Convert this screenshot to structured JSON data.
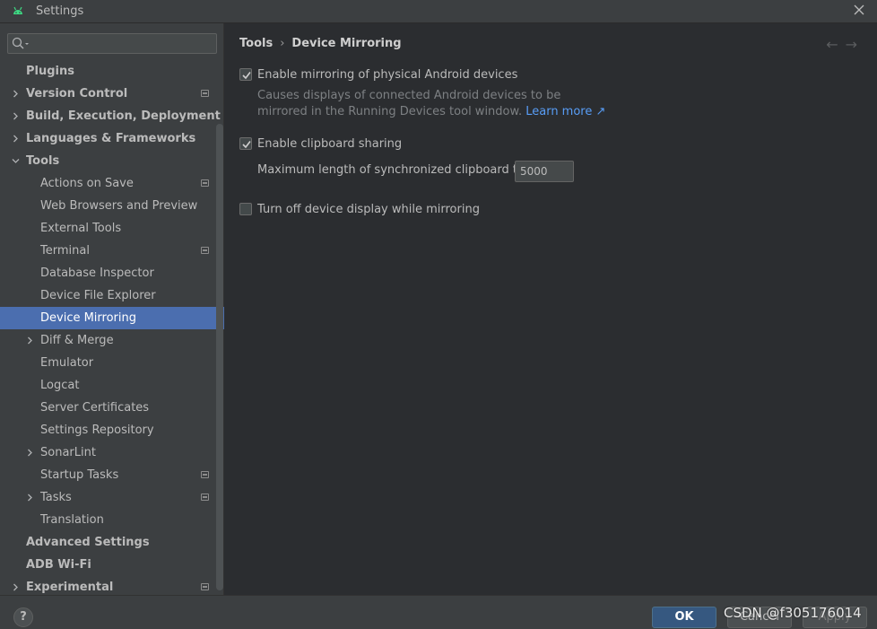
{
  "window": {
    "title": "Settings",
    "app_icon": "android-icon",
    "close_icon": "close-icon"
  },
  "sidebar": {
    "search": {
      "placeholder": "",
      "icon": "search-icon"
    },
    "items": [
      {
        "label": "Plugins",
        "level": 0,
        "bold": true,
        "expandable": false,
        "badge": false
      },
      {
        "label": "Version Control",
        "level": 0,
        "bold": true,
        "expandable": true,
        "expanded": false,
        "badge": true
      },
      {
        "label": "Build, Execution, Deployment",
        "level": 0,
        "bold": true,
        "expandable": true,
        "expanded": false,
        "badge": false
      },
      {
        "label": "Languages & Frameworks",
        "level": 0,
        "bold": true,
        "expandable": true,
        "expanded": false,
        "badge": false
      },
      {
        "label": "Tools",
        "level": 0,
        "bold": true,
        "expandable": true,
        "expanded": true,
        "badge": false
      },
      {
        "label": "Actions on Save",
        "level": 1,
        "bold": false,
        "expandable": false,
        "badge": true
      },
      {
        "label": "Web Browsers and Preview",
        "level": 1,
        "bold": false,
        "expandable": false,
        "badge": false
      },
      {
        "label": "External Tools",
        "level": 1,
        "bold": false,
        "expandable": false,
        "badge": false
      },
      {
        "label": "Terminal",
        "level": 1,
        "bold": false,
        "expandable": false,
        "badge": true
      },
      {
        "label": "Database Inspector",
        "level": 1,
        "bold": false,
        "expandable": false,
        "badge": false
      },
      {
        "label": "Device File Explorer",
        "level": 1,
        "bold": false,
        "expandable": false,
        "badge": false
      },
      {
        "label": "Device Mirroring",
        "level": 1,
        "bold": false,
        "expandable": false,
        "badge": false,
        "selected": true
      },
      {
        "label": "Diff & Merge",
        "level": 1,
        "bold": false,
        "expandable": true,
        "expanded": false,
        "badge": false
      },
      {
        "label": "Emulator",
        "level": 1,
        "bold": false,
        "expandable": false,
        "badge": false
      },
      {
        "label": "Logcat",
        "level": 1,
        "bold": false,
        "expandable": false,
        "badge": false
      },
      {
        "label": "Server Certificates",
        "level": 1,
        "bold": false,
        "expandable": false,
        "badge": false
      },
      {
        "label": "Settings Repository",
        "level": 1,
        "bold": false,
        "expandable": false,
        "badge": false
      },
      {
        "label": "SonarLint",
        "level": 1,
        "bold": false,
        "expandable": true,
        "expanded": false,
        "badge": false
      },
      {
        "label": "Startup Tasks",
        "level": 1,
        "bold": false,
        "expandable": false,
        "badge": true
      },
      {
        "label": "Tasks",
        "level": 1,
        "bold": false,
        "expandable": true,
        "expanded": false,
        "badge": true
      },
      {
        "label": "Translation",
        "level": 1,
        "bold": false,
        "expandable": false,
        "badge": false
      },
      {
        "label": "Advanced Settings",
        "level": 0,
        "bold": true,
        "expandable": false,
        "badge": false
      },
      {
        "label": "ADB Wi-Fi",
        "level": 0,
        "bold": true,
        "expandable": false,
        "badge": false
      },
      {
        "label": "Experimental",
        "level": 0,
        "bold": true,
        "expandable": true,
        "expanded": false,
        "badge": true
      }
    ]
  },
  "content": {
    "breadcrumb": {
      "parent": "Tools",
      "separator": "›",
      "current": "Device Mirroring"
    },
    "nav": {
      "back": "←",
      "forward": "→"
    },
    "enable_mirroring": {
      "label": "Enable mirroring of physical Android devices",
      "checked": true,
      "description": "Causes displays of connected Android devices to be mirrored in the Running Devices tool window.",
      "link": "Learn more ↗"
    },
    "clipboard": {
      "label": "Enable clipboard sharing",
      "checked": true,
      "max_length_label": "Maximum length of synchronized clipboard text:",
      "max_length_value": "5000"
    },
    "turn_off_display": {
      "label": "Turn off device display while mirroring",
      "checked": false
    }
  },
  "footer": {
    "help": "?",
    "ok": "OK",
    "cancel": "Cancel",
    "apply": "Apply",
    "watermark": "CSDN @f305176014"
  },
  "colors": {
    "background": "#2b2d30",
    "sidebar": "#3c3f41",
    "selection": "#4b6eaf",
    "link": "#589df6",
    "ok_button": "#365880",
    "android_green": "#3ddc84"
  }
}
